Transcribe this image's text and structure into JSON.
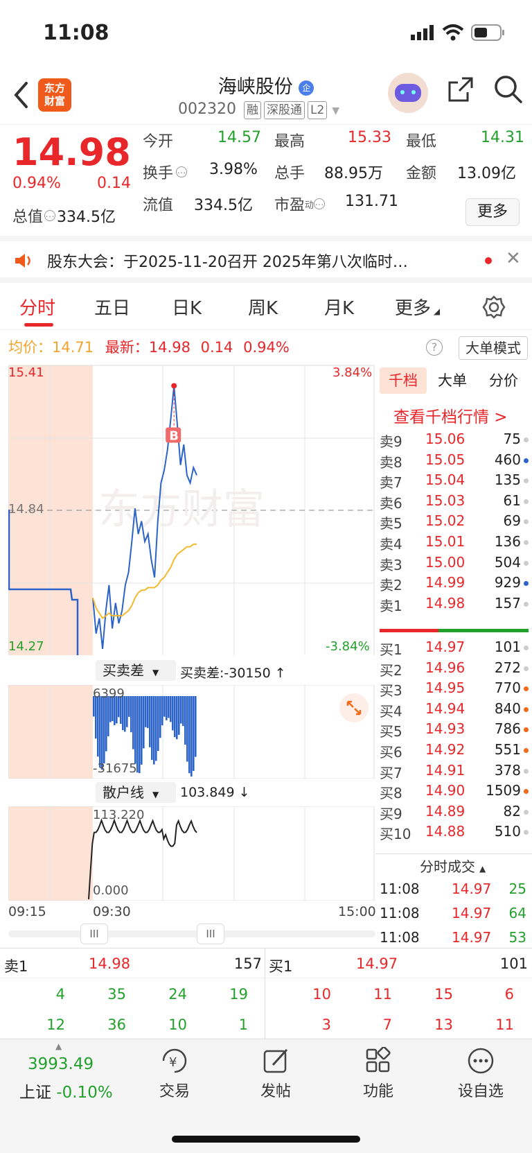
{
  "status_bar": {
    "time": "11:08"
  },
  "header": {
    "logo_line1": "东方",
    "logo_line2": "财富",
    "name": "海峡股份",
    "badge": "企",
    "code": "002320",
    "tags": [
      "融",
      "深股通",
      "L2"
    ]
  },
  "quote": {
    "price": "14.98",
    "pct": "0.94%",
    "change": "0.14",
    "open_label": "今开",
    "open": "14.57",
    "high_label": "最高",
    "high": "15.33",
    "low_label": "最低",
    "low": "14.31",
    "turnover_label": "换手",
    "turnover": "3.98%",
    "volume_label": "总手",
    "volume": "88.95万",
    "amount_label": "金额",
    "amount": "13.09亿",
    "mcap_label": "总值",
    "mcap": "334.5亿",
    "float_label": "流值",
    "float_cap": "334.5亿",
    "pe_label": "市盈",
    "pe_sup": "动",
    "pe": "131.71",
    "more": "更多"
  },
  "notice": {
    "text": "股东大会：于2025-11-20召开 2025年第八次临时…"
  },
  "tabs": [
    "分时",
    "五日",
    "日K",
    "周K",
    "月K",
    "更多"
  ],
  "info": {
    "avg_label": "均价：",
    "avg": "14.71",
    "latest_label": "最新：",
    "latest": "14.98",
    "chg": "0.14",
    "pct": "0.94%",
    "help": "?",
    "mode": "大单模式"
  },
  "chart": {
    "y_top": "15.41",
    "y_mid": "14.84",
    "y_bottom": "14.27",
    "pct_top": "3.84%",
    "pct_bottom": "-3.84%",
    "marker": "B",
    "watermark": "东方财富",
    "sub1_label": "买卖差",
    "sub1_value": "买卖差:-30150 ↑",
    "sub1_top": "6399",
    "sub1_bottom": "-31675",
    "sub2_label": "散户线",
    "sub2_value": "103.849 ↓",
    "sub2_top": "113.220",
    "sub2_bottom": "0.000",
    "time_start": "09:15",
    "time_open": "09:30",
    "time_end": "15:00",
    "slider_handle": "III"
  },
  "chart_data": {
    "type": "line",
    "x_range": [
      "09:15",
      "15:00"
    ],
    "ylim": [
      14.27,
      15.41
    ],
    "ref_price": 14.84,
    "series": [
      {
        "name": "最新",
        "values": [
          14.5,
          14.36,
          14.42,
          14.3,
          14.45,
          14.55,
          14.38,
          14.48,
          14.4,
          14.45,
          14.55,
          14.6,
          14.72,
          14.85,
          14.75,
          14.8,
          14.72,
          14.75,
          14.65,
          14.58,
          14.8,
          14.95,
          15.0,
          15.08,
          15.2,
          15.33,
          15.18,
          15.02,
          15.1,
          14.98,
          14.95,
          15.01,
          14.98
        ]
      },
      {
        "name": "均价",
        "values": [
          14.5,
          14.46,
          14.44,
          14.42,
          14.43,
          14.44,
          14.43,
          14.43,
          14.43,
          14.43,
          14.44,
          14.45,
          14.47,
          14.5,
          14.52,
          14.53,
          14.53,
          14.54,
          14.54,
          14.54,
          14.55,
          14.57,
          14.58,
          14.6,
          14.62,
          14.65,
          14.67,
          14.68,
          14.69,
          14.7,
          14.7,
          14.71,
          14.71
        ]
      }
    ]
  },
  "tabs_right": [
    "千档",
    "大单",
    "分价"
  ],
  "qian_dang_link": "查看千档行情 >",
  "sell_book": [
    {
      "label": "卖9",
      "price": "15.06",
      "vol": "75",
      "dot": "#ccc"
    },
    {
      "label": "卖8",
      "price": "15.05",
      "vol": "460",
      "dot": "#2b63c9"
    },
    {
      "label": "卖7",
      "price": "15.04",
      "vol": "135",
      "dot": "#ccc"
    },
    {
      "label": "卖6",
      "price": "15.03",
      "vol": "61",
      "dot": "#ccc"
    },
    {
      "label": "卖5",
      "price": "15.02",
      "vol": "69",
      "dot": "#ccc"
    },
    {
      "label": "卖4",
      "price": "15.01",
      "vol": "136",
      "dot": "#ccc"
    },
    {
      "label": "卖3",
      "price": "15.00",
      "vol": "504",
      "dot": "#ccc"
    },
    {
      "label": "卖2",
      "price": "14.99",
      "vol": "929",
      "dot": "#2b63c9"
    },
    {
      "label": "卖1",
      "price": "14.98",
      "vol": "157",
      "dot": "#ccc"
    }
  ],
  "buy_book": [
    {
      "label": "买1",
      "price": "14.97",
      "vol": "101",
      "dot": "#ccc"
    },
    {
      "label": "买2",
      "price": "14.96",
      "vol": "272",
      "dot": "#ccc"
    },
    {
      "label": "买3",
      "price": "14.95",
      "vol": "770",
      "dot": "#f06a1a"
    },
    {
      "label": "买4",
      "price": "14.94",
      "vol": "840",
      "dot": "#f06a1a"
    },
    {
      "label": "买5",
      "price": "14.93",
      "vol": "786",
      "dot": "#f06a1a"
    },
    {
      "label": "买6",
      "price": "14.92",
      "vol": "551",
      "dot": "#f06a1a"
    },
    {
      "label": "买7",
      "price": "14.91",
      "vol": "378",
      "dot": "#ccc"
    },
    {
      "label": "买8",
      "price": "14.90",
      "vol": "1509",
      "dot": "#f06a1a"
    },
    {
      "label": "买9",
      "price": "14.89",
      "vol": "82",
      "dot": "#ccc"
    },
    {
      "label": "买10",
      "price": "14.88",
      "vol": "510",
      "dot": "#ccc"
    }
  ],
  "trades_header": "分时成交",
  "trades": [
    {
      "time": "11:08",
      "price": "14.97",
      "vol": "25"
    },
    {
      "time": "11:08",
      "price": "14.97",
      "vol": "64"
    },
    {
      "time": "11:08",
      "price": "14.97",
      "vol": "53"
    }
  ],
  "summary": {
    "sell_label": "卖1",
    "sell_price": "14.98",
    "sell_vol": "157",
    "buy_label": "买1",
    "buy_price": "14.97",
    "buy_vol": "101",
    "sell_row1": [
      "4",
      "35",
      "24",
      "19"
    ],
    "sell_row2": [
      "12",
      "36",
      "10",
      "1"
    ],
    "buy_row1": [
      "10",
      "11",
      "15",
      "6"
    ],
    "buy_row2": [
      "3",
      "7",
      "13",
      "11"
    ]
  },
  "bottom": {
    "index_value": "3993.49",
    "index_name": "上证",
    "index_pct": "-0.10%",
    "items": [
      "交易",
      "发帖",
      "功能",
      "设自选"
    ]
  },
  "colors": {
    "up": "#e8272b",
    "down": "#22a02c",
    "line": "#2b63c9",
    "avg": "#f2b92e",
    "premarket": "#fde3d6"
  }
}
